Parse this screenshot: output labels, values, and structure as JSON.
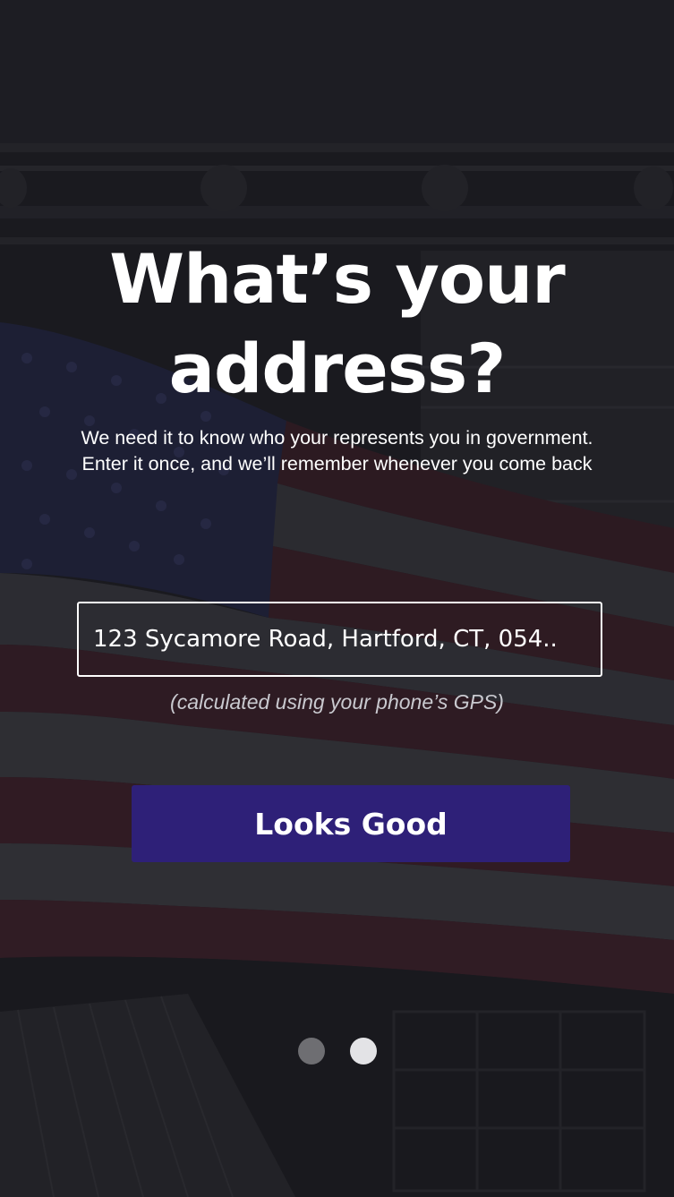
{
  "onboarding": {
    "title": "What’s your address?",
    "subtitle_line1": "We need it to know who your represents you in government.",
    "subtitle_line2": "Enter it once, and we’ll remember whenever you come back",
    "address_value": "123 Sycamore Road, Hartford, CT, 054..",
    "gps_note": "(calculated using your phone’s GPS)",
    "confirm_label": "Looks Good"
  },
  "pager": {
    "total_pages": 2,
    "current_page": 2
  },
  "colors": {
    "button_background": "#2e2078",
    "text": "#ffffff",
    "note_text": "#c9c9cf",
    "dot_inactive": "#6e6e72",
    "dot_active": "#e3e3e6"
  }
}
